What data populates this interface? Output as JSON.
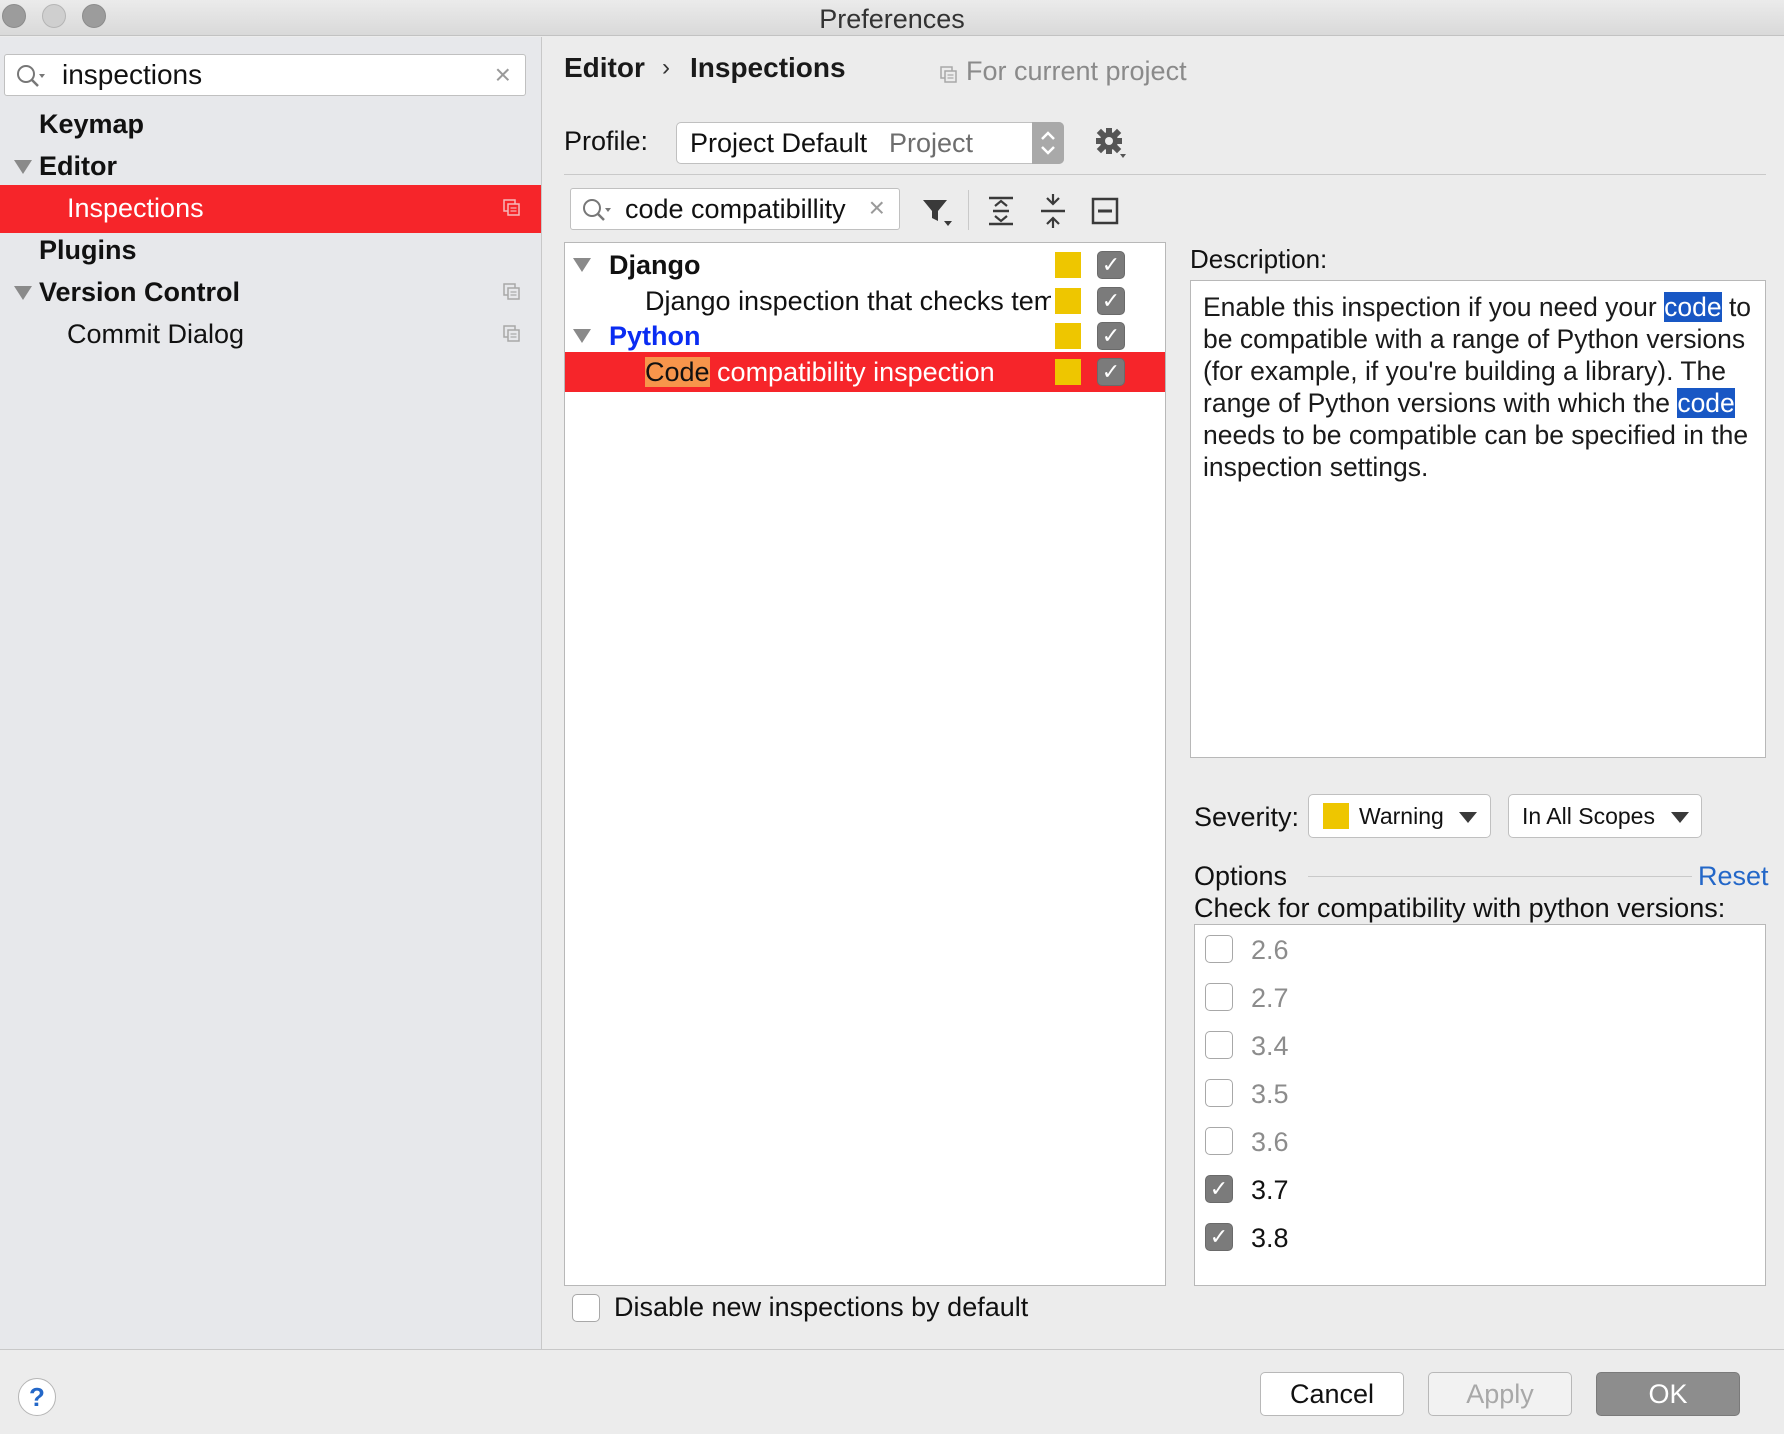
{
  "window": {
    "title": "Preferences"
  },
  "sidebar": {
    "search_value": "inspections",
    "items": [
      {
        "label": "Keymap"
      },
      {
        "label": "Editor"
      },
      {
        "label": "Inspections"
      },
      {
        "label": "Plugins"
      },
      {
        "label": "Version Control"
      },
      {
        "label": "Commit Dialog"
      }
    ]
  },
  "header": {
    "crumb_parent": "Editor",
    "crumb_sep": "›",
    "crumb_current": "Inspections",
    "scope_note": "For current project"
  },
  "profile": {
    "label": "Profile:",
    "name": "Project Default",
    "kind": "Project"
  },
  "filter": {
    "value": "code compatibillity"
  },
  "tree": {
    "django_group": "Django",
    "django_item": "Django inspection that checks template",
    "python_group": "Python",
    "selected_item_match": "Code",
    "selected_item_rest": " compatibility inspection",
    "severity_color": "#eec600",
    "highlight_color": "#f7954b"
  },
  "disable_new": {
    "label": "Disable new inspections by default",
    "checked": false
  },
  "description": {
    "label": "Description:",
    "parts": [
      "Enable this inspection if you need your ",
      "code",
      " to be compatible with a range of Python versions (for example, if you're building a library). The range of Python versions with which the ",
      "code",
      " needs to be compatible can be specified in the inspection settings."
    ]
  },
  "severity": {
    "label": "Severity:",
    "value": "Warning",
    "scope": "In All Scopes"
  },
  "options": {
    "label": "Options",
    "reset": "Reset",
    "check_for": "Check for compatibility with python versions:",
    "versions": [
      {
        "v": "2.6",
        "checked": false
      },
      {
        "v": "2.7",
        "checked": false
      },
      {
        "v": "3.4",
        "checked": false
      },
      {
        "v": "3.5",
        "checked": false
      },
      {
        "v": "3.6",
        "checked": false
      },
      {
        "v": "3.7",
        "checked": true
      },
      {
        "v": "3.8",
        "checked": true
      }
    ]
  },
  "footer": {
    "help": "?",
    "cancel": "Cancel",
    "apply": "Apply",
    "ok": "OK"
  },
  "colors": {
    "selection": "#f6252a",
    "link": "#2367c8",
    "text_match": "#1857c4"
  }
}
